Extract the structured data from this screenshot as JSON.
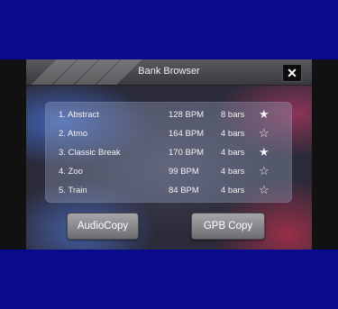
{
  "window": {
    "title": "Bank Browser",
    "close_label": "✕"
  },
  "banks": [
    {
      "name": "1. Abstract",
      "bpm": "128 BPM",
      "bars": "8 bars",
      "starred": true,
      "star": "★"
    },
    {
      "name": "2. Atmo",
      "bpm": "164 BPM",
      "bars": "4 bars",
      "starred": false,
      "star": "☆"
    },
    {
      "name": "3. Classic Break",
      "bpm": "170 BPM",
      "bars": "4 bars",
      "starred": true,
      "star": "★"
    },
    {
      "name": "4. Zoo",
      "bpm": "99 BPM",
      "bars": "4 bars",
      "starred": false,
      "star": "☆"
    },
    {
      "name": "5. Train",
      "bpm": "84 BPM",
      "bars": "4 bars",
      "starred": false,
      "star": "☆"
    }
  ],
  "buttons": {
    "audio_copy": "AudioCopy",
    "gpb_copy": "GPB Copy"
  },
  "colors": {
    "background": "#0a0a8c",
    "screen_accent_blue": "#4678e6",
    "screen_accent_red": "#d23250"
  }
}
